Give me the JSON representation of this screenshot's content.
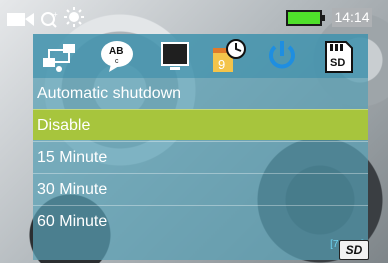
{
  "status_bar": {
    "icons": [
      "video-camera-icon",
      "scene-select-icon",
      "white-balance-icon"
    ],
    "battery": "battery-full-icon",
    "time": "14:14"
  },
  "tabs": [
    {
      "icon": "network-settings-icon"
    },
    {
      "icon": "language-icon",
      "label": "AB"
    },
    {
      "icon": "display-icon"
    },
    {
      "icon": "date-time-icon",
      "label": "9"
    },
    {
      "icon": "power-icon"
    },
    {
      "icon": "sd-card-icon",
      "label": "SD"
    }
  ],
  "menu": {
    "title": "Automatic shutdown",
    "options": [
      "Disable",
      "15 Minute",
      "30 Minute",
      "60 Minute"
    ],
    "selected_index": 0
  },
  "storage": {
    "capacity": "[7.3GB]",
    "card_label": "SD"
  },
  "colors": {
    "selection": "#a7c53d",
    "panel": "#58a0b4",
    "capacity_text": "#6fd3f0"
  }
}
